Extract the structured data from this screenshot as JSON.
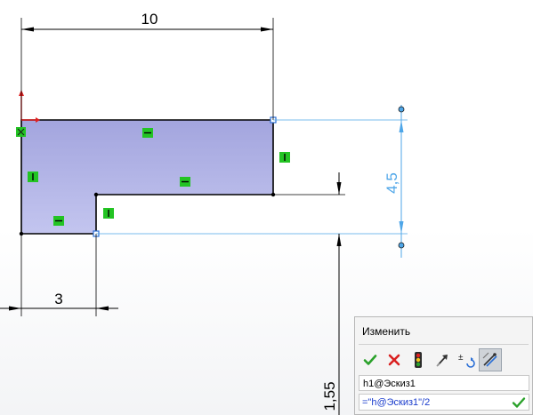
{
  "dimensions": {
    "top_width": "10",
    "left_segment": "3",
    "height_right": "4,5",
    "step_height": "1,55"
  },
  "modify_dialog": {
    "title": "Изменить",
    "toolbar": [
      {
        "name": "accept-icon",
        "color": "#2aa12a"
      },
      {
        "name": "cancel-icon",
        "color": "#d92020"
      },
      {
        "name": "rebuild-icon",
        "color": "#333333"
      },
      {
        "name": "mark-for-drawing-icon",
        "color": "#333333"
      },
      {
        "name": "reverse-sense-icon",
        "color": "#333333"
      },
      {
        "name": "dimension-options-icon",
        "color": "#333333"
      }
    ],
    "dimension_name": "h1@Эскиз1",
    "value_expression": "=\"h@Эскиз1\"/2"
  },
  "colors": {
    "region_fill_top": "#a6a8e0",
    "region_fill_bottom": "#c2c4ee",
    "sketch_line": "#000000",
    "dim_line_black": "#000000",
    "dim_line_blue": "#4ea6e8",
    "relation_marker": "#23c423",
    "origin": "#e02020"
  }
}
